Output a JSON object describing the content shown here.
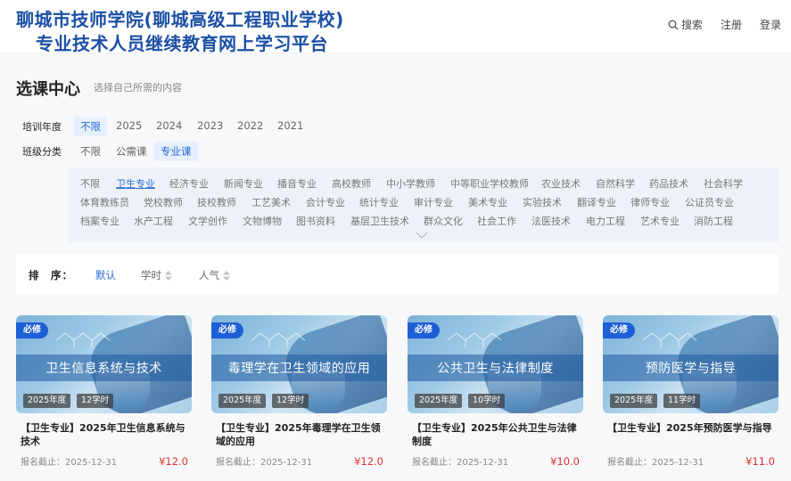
{
  "header": {
    "title_line1": "聊城市技师学院(聊城高级工程职业学校)",
    "title_line2": "专业技术人员继续教育网上学习平台",
    "nav": {
      "search": "搜索",
      "register": "注册",
      "login": "登录"
    }
  },
  "page": {
    "title": "选课中心",
    "subtitle": "选择自己所需的内容"
  },
  "filters": {
    "year": {
      "label": "培训年度",
      "options": [
        "不限",
        "2025",
        "2024",
        "2023",
        "2022",
        "2021"
      ],
      "selected": "不限"
    },
    "class_type": {
      "label": "班级分类",
      "options": [
        "不限",
        "公需课",
        "专业课"
      ],
      "selected": "专业课"
    }
  },
  "categories": {
    "selected": "卫生专业",
    "rows": [
      [
        "不限",
        "卫生专业",
        "经济专业",
        "新闻专业",
        "播音专业",
        "高校教师",
        "中小学教师",
        "中等职业学校教师",
        "农业技术",
        "自然科学",
        "药品技术",
        "社会科学"
      ],
      [
        "体育教练员",
        "党校教师",
        "技校教师",
        "工艺美术",
        "会计专业",
        "统计专业",
        "审计专业",
        "美术专业",
        "实验技术",
        "翻译专业",
        "律师专业",
        "公证员专业"
      ],
      [
        "档案专业",
        "水产工程",
        "文学创作",
        "文物博物",
        "图书资料",
        "基层卫生技术",
        "群众文化",
        "社会工作",
        "法医技术",
        "电力工程",
        "艺术专业",
        "消防工程"
      ]
    ]
  },
  "sort": {
    "label": "排　序：",
    "options": [
      "默认",
      "学时",
      "人气"
    ],
    "selected": "默认"
  },
  "courses": [
    {
      "badge": "必修",
      "cover_title": "卫生信息系统与技术",
      "year": "2025年度",
      "hours": "12学时",
      "name": "【卫生专业】2025年卫生信息系统与技术",
      "deadline": "报名截止：2025-12-31",
      "price": "¥12.0"
    },
    {
      "badge": "必修",
      "cover_title": "毒理学在卫生领域的应用",
      "year": "2025年度",
      "hours": "12学时",
      "name": "【卫生专业】2025年毒理学在卫生领域的应用",
      "deadline": "报名截止：2025-12-31",
      "price": "¥12.0"
    },
    {
      "badge": "必修",
      "cover_title": "公共卫生与法律制度",
      "year": "2025年度",
      "hours": "10学时",
      "name": "【卫生专业】2025年公共卫生与法律制度",
      "deadline": "报名截止：2025-12-31",
      "price": "¥10.0"
    },
    {
      "badge": "必修",
      "cover_title": "预防医学与指导",
      "year": "2025年度",
      "hours": "11学时",
      "name": "【卫生专业】2025年预防医学与指导",
      "deadline": "报名截止：2025-12-31",
      "price": "¥11.0"
    }
  ],
  "colors": {
    "brand": "#1c4fa5",
    "accent": "#2a6bd6",
    "price": "#e0302a",
    "badge": "#1d5fd6"
  }
}
